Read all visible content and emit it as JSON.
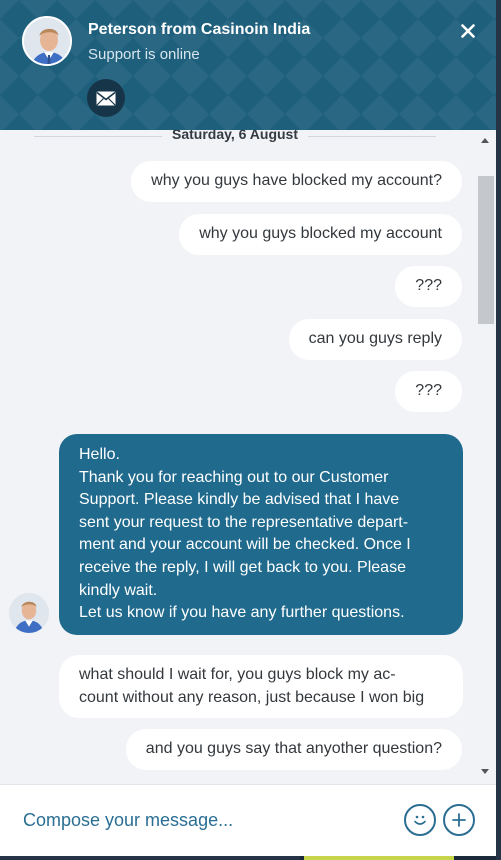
{
  "header": {
    "agent_name": "Peterson from Casinoin India",
    "status": "Support is online"
  },
  "icons": {
    "avatar": "agent-avatar-icon",
    "email": "envelope-icon",
    "close": "close-icon",
    "emoji": "smiley-icon",
    "attach": "plus-icon"
  },
  "colors": {
    "header": "#1e5f7c",
    "agent_bubble": "#1f6a8d",
    "user_bubble": "#ffffff",
    "accent": "#2a6e93"
  },
  "conversation": {
    "date": "Saturday, 6 August",
    "messages": [
      {
        "from": "user",
        "text": "why you guys have blocked my account?"
      },
      {
        "from": "user",
        "text": "why you guys blocked my account"
      },
      {
        "from": "user",
        "text": "???"
      },
      {
        "from": "user",
        "text": "can you guys reply"
      },
      {
        "from": "user",
        "text": "???"
      },
      {
        "from": "agent",
        "lines": [
          "Hello.",
          "Thank you for reaching out to our Customer",
          "Support. Please kindly be advised that I have",
          "sent your request to the representative depart-",
          "ment and your account will be checked. Once I",
          "receive the reply, I will get back to you. Please",
          "kindly wait.",
          "Let us know if you have any further questions."
        ]
      },
      {
        "from": "user",
        "lines": [
          "what should I wait for, you guys block my ac-",
          "count without any reason, just because I won big"
        ]
      },
      {
        "from": "user",
        "text": "and you guys say that anyother question?"
      }
    ]
  },
  "composer": {
    "placeholder": "Compose your message..."
  }
}
